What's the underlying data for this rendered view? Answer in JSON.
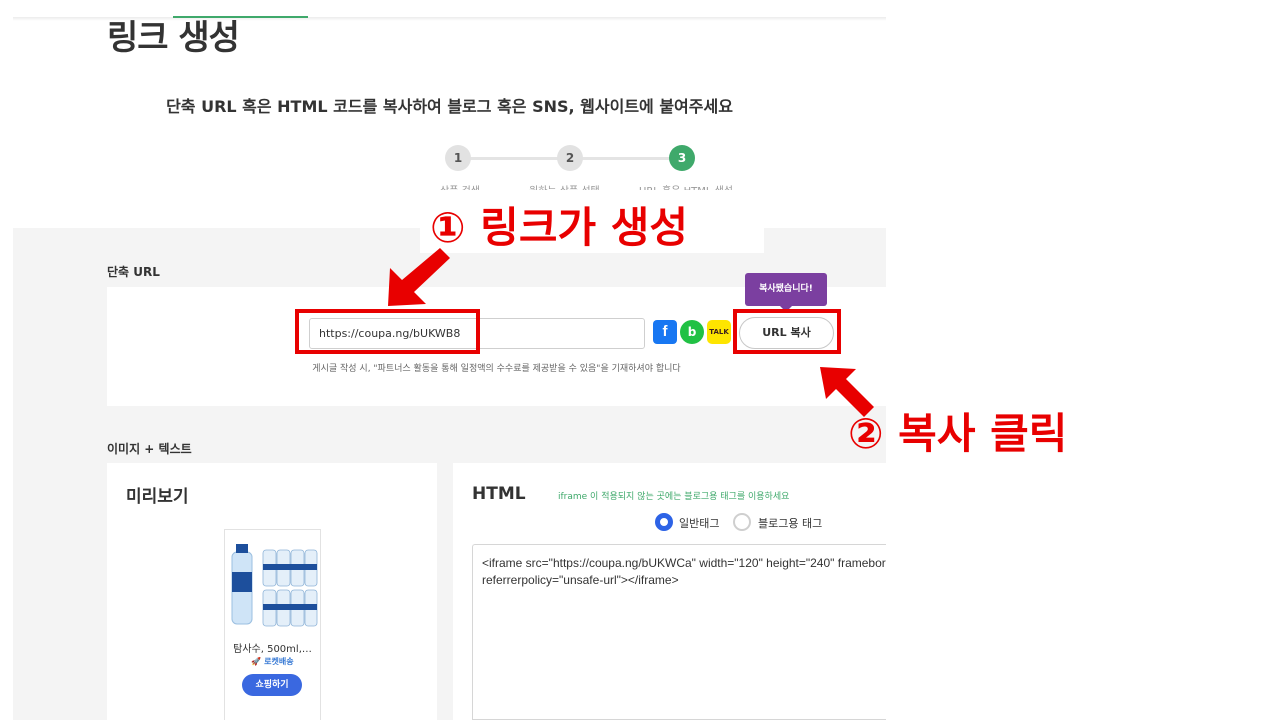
{
  "header": {
    "title": "링크 생성",
    "subtitle": "단축 URL 혹은 HTML 코드를 복사하여 블로그 혹은 SNS, 웹사이트에 붙여주세요"
  },
  "steps": [
    {
      "number": "1",
      "label": "상품 검색"
    },
    {
      "number": "2",
      "label": "원하는 상품 선택"
    },
    {
      "number": "3",
      "label": "URL 혹은 HTML 생성"
    }
  ],
  "short_url": {
    "section_label": "단축 URL",
    "value": "https://coupa.ng/bUKWB8",
    "copy_button": "URL 복사",
    "tooltip": "복사됐습니다!",
    "notice": "게시글 작성 시, \"파트너스 활동을 통해 일정액의 수수료를 제공받을 수 있음\"을 기재하셔야 합니다",
    "share_icons": [
      "facebook-icon",
      "band-icon",
      "kakaotalk-icon"
    ],
    "kakao_text": "TALK",
    "band_text": "b",
    "facebook_text": "f"
  },
  "image_text": {
    "section_label": "이미지 + 텍스트",
    "preview_title": "미리보기",
    "product_name": "탐사수, 500ml,…",
    "rocket_label": "로켓배송",
    "shop_button": "쇼핑하기",
    "html_title": "HTML",
    "iframe_note": "iframe 이 적용되지 않는 곳에는 블로그용 태그를 이용하세요",
    "radio_options": [
      {
        "label": "일반태그",
        "selected": true
      },
      {
        "label": "블로그용 태그",
        "selected": false
      }
    ],
    "code_line1": "<iframe src=\"https://coupa.ng/bUKWCa\" width=\"120\" height=\"240\" framebor",
    "code_line2": "referrerpolicy=\"unsafe-url\"></iframe>"
  },
  "annotations": {
    "step1": "① 링크가 생성",
    "step2": "② 복사 클릭",
    "color": "#e80000"
  },
  "colors": {
    "accent_green": "#3fa96b",
    "tooltip_purple": "#7b3fa0",
    "radio_blue": "#2d63e6",
    "shop_blue": "#3a68e0"
  }
}
